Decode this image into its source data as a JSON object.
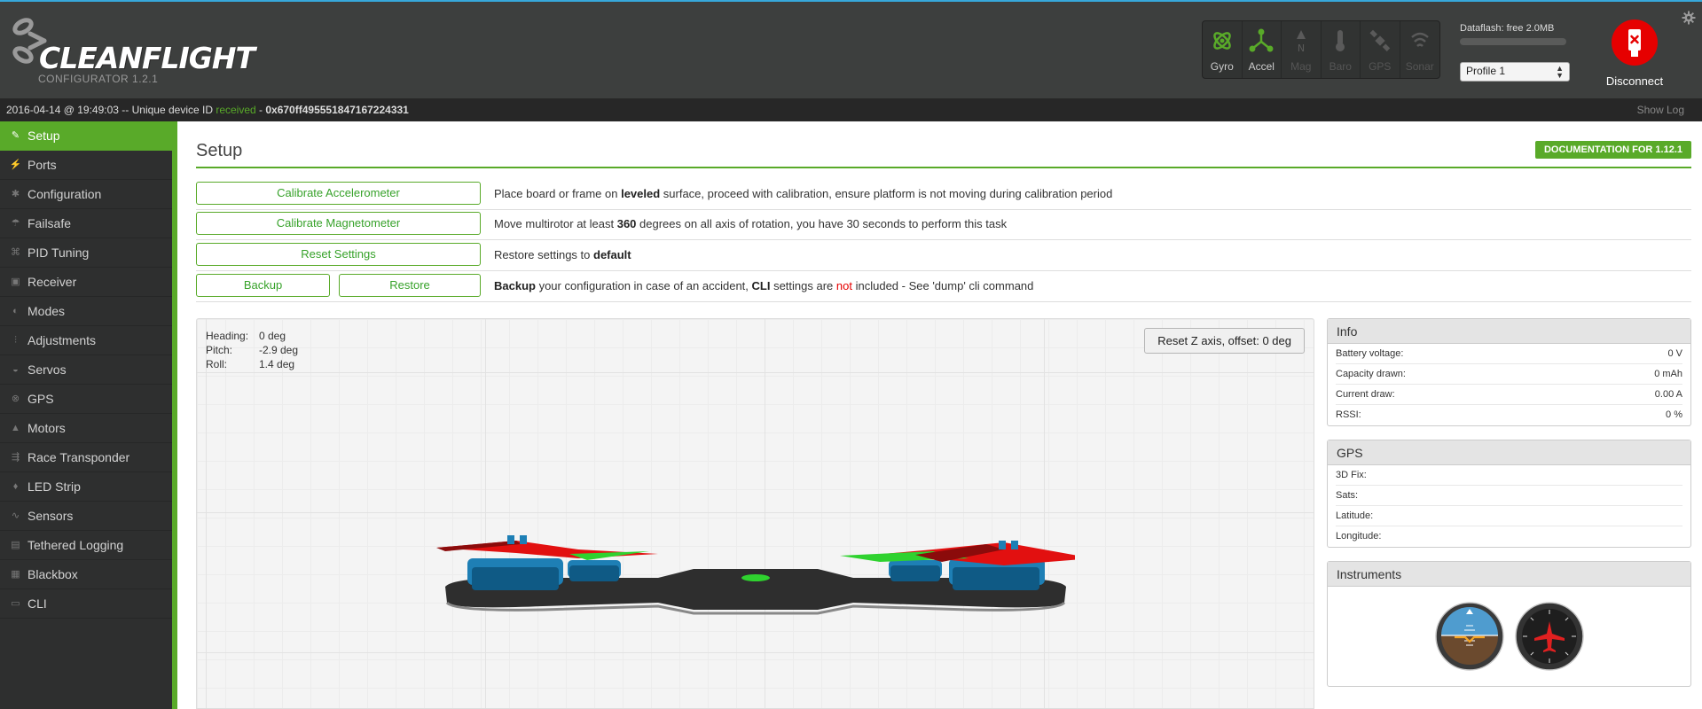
{
  "app": {
    "brand": "CLEANFLIGHT",
    "subtitle": "CONFIGURATOR  1.2.1"
  },
  "sensors": [
    {
      "label": "Gyro",
      "icon": "gyro-icon",
      "active": true
    },
    {
      "label": "Accel",
      "icon": "accel-icon",
      "active": true
    },
    {
      "label": "Mag",
      "icon": "mag-icon",
      "active": false
    },
    {
      "label": "Baro",
      "icon": "baro-icon",
      "active": false
    },
    {
      "label": "GPS",
      "icon": "gps-icon",
      "active": false
    },
    {
      "label": "Sonar",
      "icon": "sonar-icon",
      "active": false
    }
  ],
  "dataflash": {
    "label": "Dataflash: free 2.0MB"
  },
  "profile": {
    "selected": "Profile 1"
  },
  "disconnect": {
    "label": "Disconnect"
  },
  "status": {
    "timestamp": "2016-04-14 @ 19:49:03 -- Unique device ID ",
    "received": "received",
    "separator": " - ",
    "device_id": "0x670ff495551847167224331",
    "show_log": "Show Log"
  },
  "sidebar": {
    "items": [
      {
        "label": "Setup",
        "icon": "wrench-icon",
        "active": true
      },
      {
        "label": "Ports",
        "icon": "plug-icon"
      },
      {
        "label": "Configuration",
        "icon": "gear-icon"
      },
      {
        "label": "Failsafe",
        "icon": "parachute-icon"
      },
      {
        "label": "PID Tuning",
        "icon": "pid-icon"
      },
      {
        "label": "Receiver",
        "icon": "receiver-icon"
      },
      {
        "label": "Modes",
        "icon": "modes-icon"
      },
      {
        "label": "Adjustments",
        "icon": "sliders-icon"
      },
      {
        "label": "Servos",
        "icon": "servo-icon"
      },
      {
        "label": "GPS",
        "icon": "satellite-icon"
      },
      {
        "label": "Motors",
        "icon": "motor-icon"
      },
      {
        "label": "Race Transponder",
        "icon": "transponder-icon"
      },
      {
        "label": "LED Strip",
        "icon": "led-icon"
      },
      {
        "label": "Sensors",
        "icon": "pulse-icon"
      },
      {
        "label": "Tethered Logging",
        "icon": "logging-icon"
      },
      {
        "label": "Blackbox",
        "icon": "blackbox-icon"
      },
      {
        "label": "CLI",
        "icon": "terminal-icon"
      }
    ]
  },
  "main": {
    "title": "Setup",
    "doc_button": "DOCUMENTATION FOR 1.12.1",
    "calibration": {
      "accel_button": "Calibrate Accelerometer",
      "accel_text": [
        "Place board or frame on ",
        "leveled",
        " surface, proceed with calibration, ensure platform is not moving during calibration period"
      ],
      "mag_button": "Calibrate Magnetometer",
      "mag_text": [
        "Move multirotor at least ",
        "360",
        " degrees on all axis of rotation, you have 30 seconds to perform this task"
      ],
      "reset_button": "Reset Settings",
      "reset_text": [
        "Restore settings to ",
        "default"
      ],
      "backup_button": "Backup",
      "restore_button": "Restore",
      "backup_text": [
        "Backup",
        " your configuration in case of an accident, ",
        "CLI",
        " settings are ",
        "not",
        " included - See 'dump' cli command"
      ]
    },
    "attitude": {
      "heading_label": "Heading:",
      "heading": "0 deg",
      "pitch_label": "Pitch:",
      "pitch": "-2.9 deg",
      "roll_label": "Roll:",
      "roll": "1.4 deg"
    },
    "reset_z": "Reset Z axis, offset: 0 deg"
  },
  "info": {
    "title": "Info",
    "rows": [
      {
        "label": "Battery voltage:",
        "value": "0 V"
      },
      {
        "label": "Capacity drawn:",
        "value": "0 mAh"
      },
      {
        "label": "Current draw:",
        "value": "0.00 A"
      },
      {
        "label": "RSSI:",
        "value": "0 %"
      }
    ]
  },
  "gps": {
    "title": "GPS",
    "rows": [
      {
        "label": "3D Fix:",
        "value": ""
      },
      {
        "label": "Sats:",
        "value": ""
      },
      {
        "label": "Latitude:",
        "value": ""
      },
      {
        "label": "Longitude:",
        "value": ""
      }
    ]
  },
  "instruments": {
    "title": "Instruments"
  },
  "colors": {
    "accent": "#59aa29",
    "header": "#3d3f3e",
    "sidebar": "#2e2f2f",
    "danger": "#e60000"
  }
}
